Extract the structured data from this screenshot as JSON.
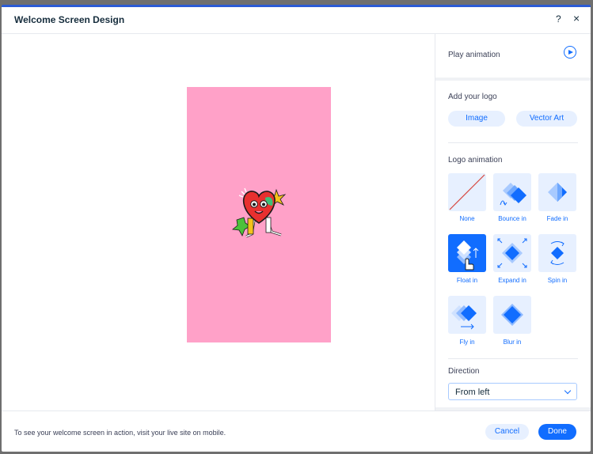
{
  "dialog": {
    "title": "Welcome Screen Design",
    "help_icon": "?",
    "close_icon": "×"
  },
  "panel": {
    "play_animation": "Play animation",
    "add_logo": "Add your logo",
    "logo_buttons": {
      "image": "Image",
      "vector_art": "Vector Art"
    },
    "logo_animation": "Logo animation",
    "animations": [
      {
        "label": "None",
        "icon": "none-slash-icon"
      },
      {
        "label": "Bounce in",
        "icon": "bounce-in-icon"
      },
      {
        "label": "Fade in",
        "icon": "fade-in-icon"
      },
      {
        "label": "Float in",
        "icon": "float-in-icon",
        "selected": true
      },
      {
        "label": "Expand in",
        "icon": "expand-in-icon"
      },
      {
        "label": "Spin in",
        "icon": "spin-in-icon"
      },
      {
        "label": "Fly in",
        "icon": "fly-in-icon"
      },
      {
        "label": "Blur in",
        "icon": "blur-in-icon"
      }
    ],
    "direction_label": "Direction",
    "direction_value": "From left"
  },
  "footer": {
    "hint": "To see your welcome screen in action, visit your live site on mobile.",
    "cancel": "Cancel",
    "done": "Done"
  },
  "colors": {
    "accent": "#116dff",
    "accent_light": "#e7f0ff",
    "preview_bg": "#ffa1c8"
  }
}
